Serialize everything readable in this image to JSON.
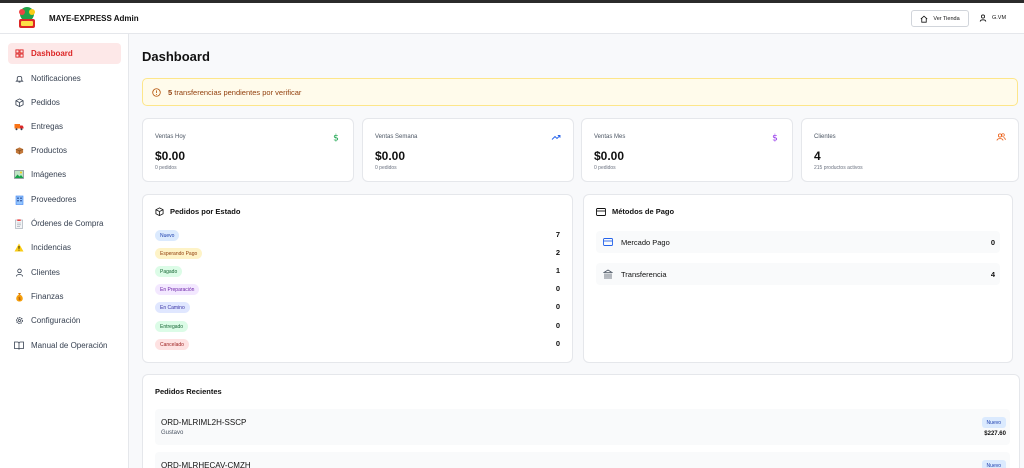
{
  "app": {
    "brand": "MAYE-EXPRESS Admin",
    "store_button": "Ver Tienda",
    "user_initials": "G.VM",
    "accent_color": "#dc2626"
  },
  "sidebar": {
    "items": [
      {
        "label": "Dashboard",
        "icon": "dashboard-icon",
        "active": true
      },
      {
        "label": "Notificaciones",
        "icon": "bell-icon"
      },
      {
        "label": "Pedidos",
        "icon": "package-icon"
      },
      {
        "label": "Entregas",
        "icon": "truck-icon"
      },
      {
        "label": "Productos",
        "icon": "box-icon"
      },
      {
        "label": "Imágenes",
        "icon": "image-icon"
      },
      {
        "label": "Proveedores",
        "icon": "building-icon"
      },
      {
        "label": "Órdenes de Compra",
        "icon": "clipboard-icon"
      },
      {
        "label": "Incidencias",
        "icon": "warning-icon"
      },
      {
        "label": "Clientes",
        "icon": "user-icon"
      },
      {
        "label": "Finanzas",
        "icon": "money-bag-icon"
      },
      {
        "label": "Configuración",
        "icon": "gear-icon"
      },
      {
        "label": "Manual de Operación",
        "icon": "book-icon"
      }
    ]
  },
  "main": {
    "title": "Dashboard",
    "alert": {
      "count": "5",
      "text": "transferencias pendientes por verificar"
    },
    "stats": [
      {
        "label": "Ventas Hoy",
        "value": "$0.00",
        "sub": "0 pedidos",
        "icon": "dollar-icon",
        "color": "#16a34a"
      },
      {
        "label": "Ventas Semana",
        "value": "$0.00",
        "sub": "0 pedidos",
        "icon": "trending-up-icon",
        "color": "#2563eb"
      },
      {
        "label": "Ventas Mes",
        "value": "$0.00",
        "sub": "0 pedidos",
        "icon": "dollar-icon",
        "color": "#9333ea"
      },
      {
        "label": "Clientes",
        "value": "4",
        "sub": "215 productos activos",
        "icon": "users-icon",
        "color": "#ea580c"
      }
    ],
    "orders_by_status": {
      "title": "Pedidos por Estado",
      "rows": [
        {
          "label": "Nuevo",
          "count": "7",
          "bg": "#dbeafe",
          "fg": "#1e40af"
        },
        {
          "label": "Esperando Pago",
          "count": "2",
          "bg": "#fef3c7",
          "fg": "#92400e"
        },
        {
          "label": "Pagado",
          "count": "1",
          "bg": "#dcfce7",
          "fg": "#166534"
        },
        {
          "label": "En Preparación",
          "count": "0",
          "bg": "#f3e8ff",
          "fg": "#6b21a8"
        },
        {
          "label": "En Camino",
          "count": "0",
          "bg": "#e0e7ff",
          "fg": "#3730a3"
        },
        {
          "label": "Entregado",
          "count": "0",
          "bg": "#dcfce7",
          "fg": "#166534"
        },
        {
          "label": "Cancelado",
          "count": "0",
          "bg": "#fee2e2",
          "fg": "#991b1b"
        }
      ]
    },
    "payment_methods": {
      "title": "Métodos de Pago",
      "rows": [
        {
          "label": "Mercado Pago",
          "count": "0",
          "icon": "card-icon"
        },
        {
          "label": "Transferencia",
          "count": "4",
          "icon": "bank-icon"
        }
      ]
    },
    "recent_orders": {
      "title": "Pedidos Recientes",
      "rows": [
        {
          "id": "ORD-MLRIML2H-SSCP",
          "client": "Gustavo",
          "status": "Nuevo",
          "total": "$227.60"
        },
        {
          "id": "ORD-MLRHECAV-CMZH",
          "client": "",
          "status": "Nuevo",
          "total": ""
        }
      ]
    }
  }
}
